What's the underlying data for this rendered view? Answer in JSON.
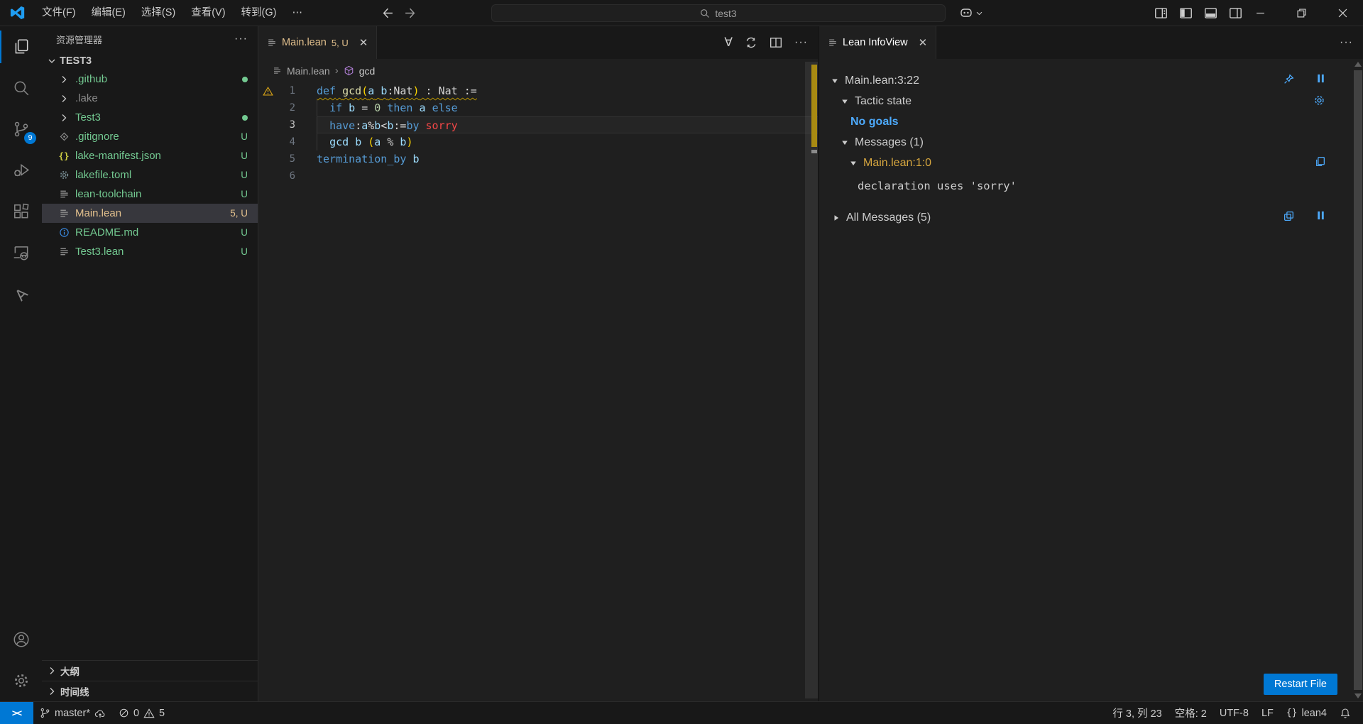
{
  "colors": {
    "accent": "#0078d4",
    "warning": "#cca700",
    "modified": "#e2c08d",
    "untracked": "#73c991",
    "ignored": "#8c8c8c"
  },
  "title_bar": {
    "menus": [
      "文件(F)",
      "编辑(E)",
      "选择(S)",
      "查看(V)",
      "转到(G)",
      "⋯"
    ],
    "search_text": "test3"
  },
  "activity_bar": {
    "items": [
      {
        "icon": "files",
        "active": true
      },
      {
        "icon": "search"
      },
      {
        "icon": "source-control",
        "badge": "9"
      },
      {
        "icon": "debug"
      },
      {
        "icon": "extensions"
      },
      {
        "icon": "remote"
      },
      {
        "icon": "lean"
      }
    ],
    "bottom": [
      {
        "icon": "account"
      },
      {
        "icon": "settings"
      }
    ]
  },
  "sidebar": {
    "title": "资源管理器",
    "root": "TEST3",
    "files": [
      {
        "name": ".github",
        "type": "folder",
        "color": "untracked",
        "badge": "dot"
      },
      {
        "name": ".lake",
        "type": "folder",
        "color": "ignored",
        "badge": ""
      },
      {
        "name": "Test3",
        "type": "folder",
        "color": "untracked",
        "badge": "dot"
      },
      {
        "name": ".gitignore",
        "icon": "git",
        "color": "untracked",
        "badge": "U"
      },
      {
        "name": "lake-manifest.json",
        "icon": "json",
        "color": "untracked",
        "badge": "U"
      },
      {
        "name": "lakefile.toml",
        "icon": "gearfile",
        "color": "untracked",
        "badge": "U"
      },
      {
        "name": "lean-toolchain",
        "icon": "lines",
        "color": "untracked",
        "badge": "U"
      },
      {
        "name": "Main.lean",
        "icon": "lines",
        "color": "modified",
        "badge": "5, U",
        "selected": true
      },
      {
        "name": "README.md",
        "icon": "info",
        "color": "untracked",
        "badge": "U"
      },
      {
        "name": "Test3.lean",
        "icon": "lines",
        "color": "untracked",
        "badge": "U"
      }
    ],
    "bottom_sections": [
      "大纲",
      "时间线"
    ]
  },
  "editor": {
    "tab": {
      "label": "Main.lean",
      "badge": "5, U"
    },
    "breadcrumb": {
      "file": "Main.lean",
      "symbol": "gcd"
    },
    "code": [
      {
        "n": "1",
        "warn": true,
        "squiggle": true,
        "tokens": [
          [
            "kw",
            "def"
          ],
          [
            "pl",
            " "
          ],
          [
            "fn",
            "gcd"
          ],
          [
            "br",
            "("
          ],
          [
            "id",
            "a"
          ],
          [
            "pl",
            " "
          ],
          [
            "id",
            "b"
          ],
          [
            "pl",
            ":"
          ],
          [
            "pl",
            "Nat"
          ],
          [
            "br",
            ")"
          ],
          [
            "pl",
            " : Nat :="
          ]
        ]
      },
      {
        "n": "2",
        "guide": true,
        "tokens": [
          [
            "pl",
            "  "
          ],
          [
            "kw",
            "if"
          ],
          [
            "pl",
            " "
          ],
          [
            "id",
            "b"
          ],
          [
            "pl",
            " = "
          ],
          [
            "num",
            "0"
          ],
          [
            "pl",
            " "
          ],
          [
            "kw",
            "then"
          ],
          [
            "pl",
            " "
          ],
          [
            "id",
            "a"
          ],
          [
            "pl",
            " "
          ],
          [
            "kw",
            "else"
          ]
        ]
      },
      {
        "n": "3",
        "guide": true,
        "current": true,
        "tokens": [
          [
            "pl",
            "  "
          ],
          [
            "kw",
            "have"
          ],
          [
            "pl",
            ":"
          ],
          [
            "id",
            "a"
          ],
          [
            "pl",
            "%"
          ],
          [
            "id",
            "b"
          ],
          [
            "pl",
            "<"
          ],
          [
            "id",
            "b"
          ],
          [
            "pl",
            ":="
          ],
          [
            "kw",
            "by"
          ],
          [
            "pl",
            " "
          ],
          [
            "err",
            "sorry"
          ]
        ]
      },
      {
        "n": "4",
        "guide": true,
        "tokens": [
          [
            "pl",
            "  "
          ],
          [
            "id",
            "gcd"
          ],
          [
            "pl",
            " "
          ],
          [
            "id",
            "b"
          ],
          [
            "pl",
            " "
          ],
          [
            "br",
            "("
          ],
          [
            "id",
            "a"
          ],
          [
            "pl",
            " % "
          ],
          [
            "id",
            "b"
          ],
          [
            "br",
            ")"
          ]
        ]
      },
      {
        "n": "5",
        "tokens": [
          [
            "kw",
            "termination_by"
          ],
          [
            "pl",
            " "
          ],
          [
            "id",
            "b"
          ]
        ]
      },
      {
        "n": "6",
        "tokens": []
      }
    ]
  },
  "infoview": {
    "tab_label": "Lean InfoView",
    "position": "Main.lean:3:22",
    "tactic_state_label": "Tactic state",
    "no_goals": "No goals",
    "messages_label": "Messages (1)",
    "message_location": "Main.lean:1:0",
    "message_text": "declaration uses 'sorry'",
    "all_messages_label": "All Messages (5)",
    "restart_button": "Restart File"
  },
  "status_bar": {
    "branch": "master*",
    "errors": "0",
    "warnings": "5",
    "right_items": [
      {
        "label": "行 3, 列 23"
      },
      {
        "label": "空格: 2"
      },
      {
        "label": "UTF-8"
      },
      {
        "label": "LF"
      },
      {
        "icon": "braces",
        "label": "lean4"
      },
      {
        "icon": "bell",
        "label": ""
      }
    ]
  }
}
